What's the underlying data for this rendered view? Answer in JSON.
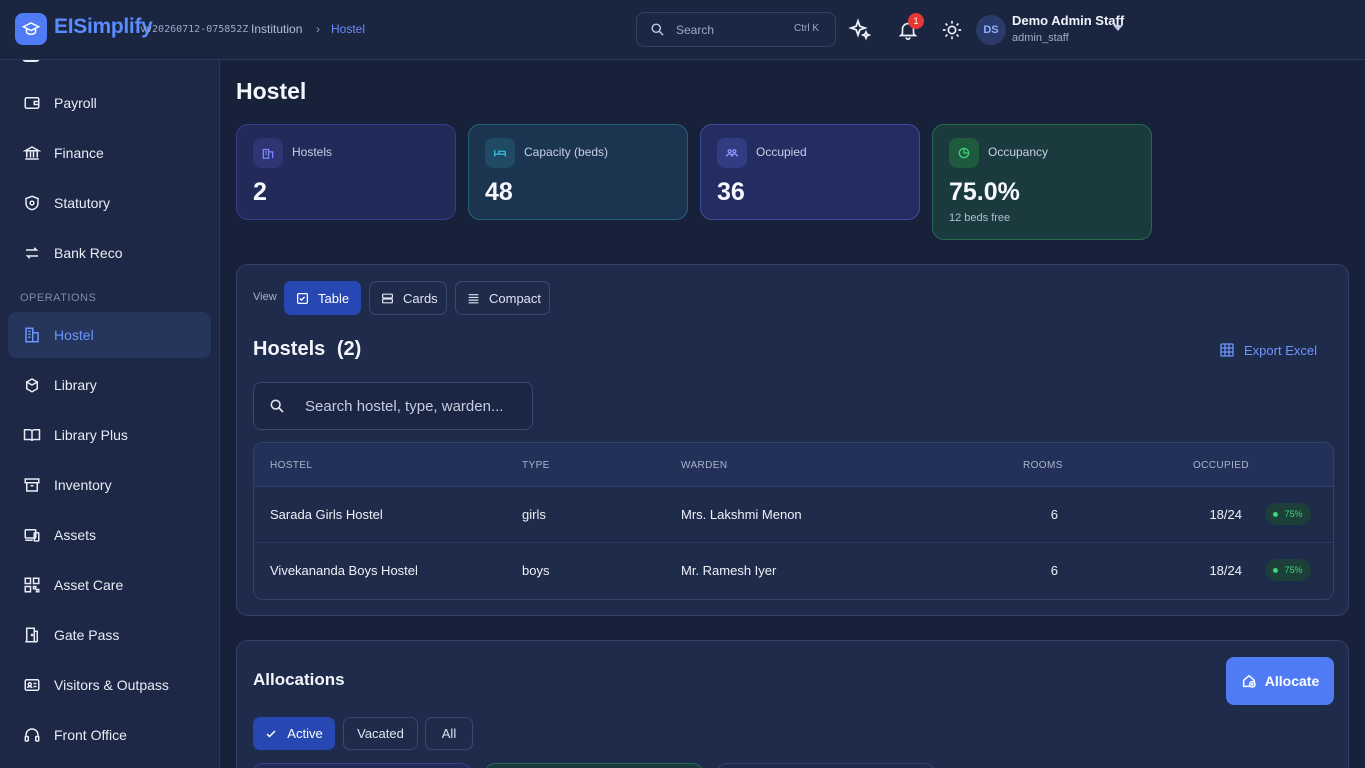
{
  "app": {
    "name": "EISimplify",
    "version": "vv20260712-075852Z",
    "breadcrumb": [
      "Institution",
      "Hostel"
    ]
  },
  "topbar": {
    "search_placeholder": "Search",
    "search_shortcut": "Ctrl K",
    "notification_count": "1",
    "user_initials": "DS",
    "user_name": "Demo Admin Staff",
    "user_role": "admin_staff"
  },
  "sidebar": {
    "section_operations": "OPERATIONS",
    "items": [
      {
        "label": "Payroll",
        "icon": "wallet-icon"
      },
      {
        "label": "Finance",
        "icon": "bank-icon"
      },
      {
        "label": "Statutory",
        "icon": "shield-icon"
      },
      {
        "label": "Bank Reco",
        "icon": "swap-icon"
      },
      {
        "label": "Hostel",
        "icon": "building-icon",
        "active": true
      },
      {
        "label": "Library",
        "icon": "book-icon"
      },
      {
        "label": "Library Plus",
        "icon": "open-book-icon"
      },
      {
        "label": "Inventory",
        "icon": "archive-icon"
      },
      {
        "label": "Assets",
        "icon": "devices-icon"
      },
      {
        "label": "Asset Care",
        "icon": "qr-icon"
      },
      {
        "label": "Gate Pass",
        "icon": "door-icon"
      },
      {
        "label": "Visitors & Outpass",
        "icon": "id-card-icon"
      },
      {
        "label": "Front Office",
        "icon": "headset-icon"
      }
    ]
  },
  "page": {
    "title": "Hostel"
  },
  "stats": [
    {
      "label": "Hostels",
      "value": "2",
      "icon": "building-icon"
    },
    {
      "label": "Capacity (beds)",
      "value": "48",
      "icon": "bed-icon"
    },
    {
      "label": "Occupied",
      "value": "36",
      "icon": "people-icon"
    },
    {
      "label": "Occupancy",
      "value": "75.0%",
      "sub": "12 beds free",
      "icon": "pie-icon"
    }
  ],
  "hostels_panel": {
    "view_label": "View",
    "views": [
      "Table",
      "Cards",
      "Compact"
    ],
    "active_view": "Table",
    "title": "Hostels",
    "count": "(2)",
    "export_label": "Export Excel",
    "search_placeholder": "Search hostel, type, warden...",
    "columns": [
      "HOSTEL",
      "TYPE",
      "WARDEN",
      "ROOMS",
      "OCCUPIED"
    ],
    "rows": [
      {
        "hostel": "Sarada Girls Hostel",
        "type": "girls",
        "warden": "Mrs. Lakshmi Menon",
        "rooms": "6",
        "occupied": "18/24",
        "pct": "75%"
      },
      {
        "hostel": "Vivekananda Boys Hostel",
        "type": "boys",
        "warden": "Mr. Ramesh Iyer",
        "rooms": "6",
        "occupied": "18/24",
        "pct": "75%"
      }
    ]
  },
  "allocations_panel": {
    "title": "Allocations",
    "allocate_label": "Allocate",
    "filters": [
      "Active",
      "Vacated",
      "All"
    ],
    "active_filter": "Active"
  },
  "colors": {
    "accent": "#4f7cf5",
    "success": "#3ed37a",
    "danger": "#e53935"
  }
}
